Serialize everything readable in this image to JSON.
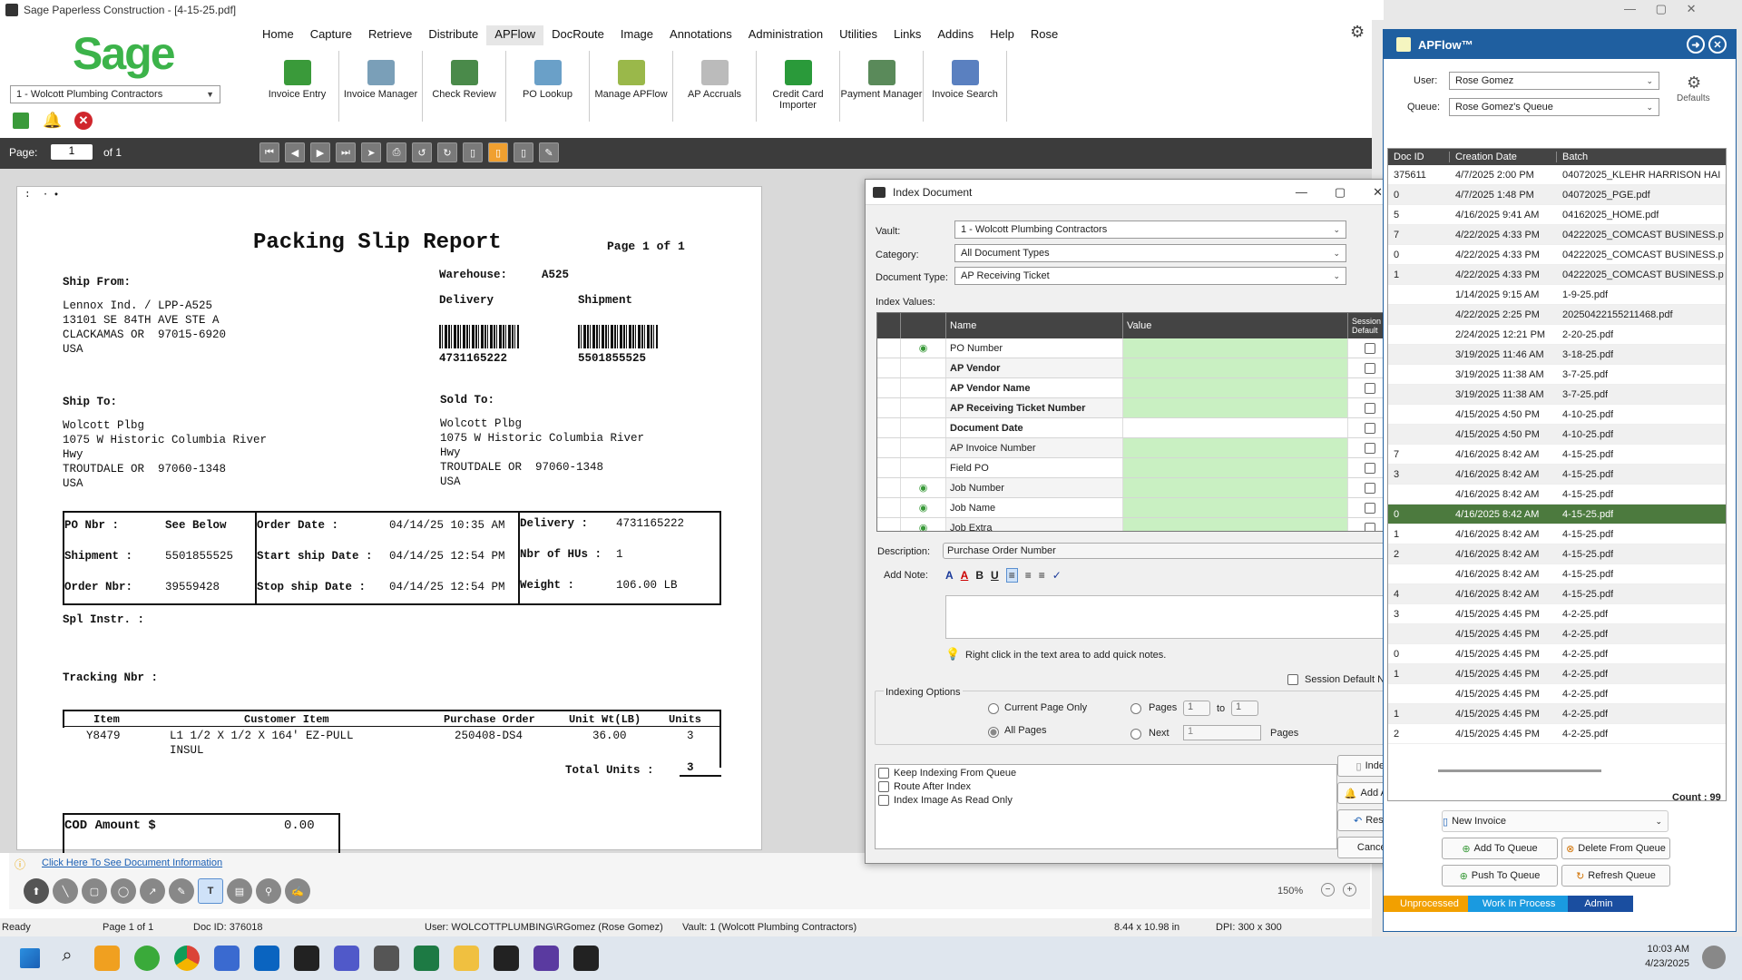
{
  "window": {
    "title": "Sage Paperless Construction - [4-15-25.pdf]"
  },
  "brand": {
    "logo": "Sage",
    "color": "#3cb34a"
  },
  "vault_select": "1 - Wolcott Plumbing Contractors",
  "menu": [
    "Home",
    "Capture",
    "Retrieve",
    "Distribute",
    "APFlow",
    "DocRoute",
    "Image",
    "Annotations",
    "Administration",
    "Utilities",
    "Links",
    "Addins",
    "Help",
    "Rose"
  ],
  "ribbon": [
    {
      "label": "Invoice Entry",
      "icon": "invoice-entry-icon",
      "color": "#3a9a3a"
    },
    {
      "label": "Invoice Manager",
      "icon": "invoice-manager-icon",
      "color": "#7a9fb8"
    },
    {
      "label": "Check Review",
      "icon": "check-review-icon",
      "color": "#4a8a4a"
    },
    {
      "label": "PO Lookup",
      "icon": "po-lookup-icon",
      "color": "#6aa0c8"
    },
    {
      "label": "Manage APFlow",
      "icon": "manage-apflow-icon",
      "color": "#9ab84a"
    },
    {
      "label": "AP Accruals",
      "icon": "ap-accruals-icon",
      "color": "#bbbbbb"
    },
    {
      "label": "Credit Card Importer",
      "icon": "credit-card-icon",
      "color": "#2a9a3a"
    },
    {
      "label": "Payment Manager",
      "icon": "payment-manager-icon",
      "color": "#5a8a5a"
    },
    {
      "label": "Invoice Search",
      "icon": "invoice-search-icon",
      "color": "#5a80c0"
    }
  ],
  "pager": {
    "label": "Page:",
    "current": "1",
    "of": "of 1"
  },
  "document": {
    "title": "Packing Slip Report",
    "page": "Page 1 of 1",
    "ship_from_label": "Ship From:",
    "ship_from": [
      "Lennox Ind. / LPP-A525",
      "13101 SE 84TH AVE STE A",
      "CLACKAMAS OR  97015-6920",
      "USA"
    ],
    "warehouse_label": "Warehouse:",
    "warehouse": "A525",
    "delivery_label": "Delivery",
    "shipment_label": "Shipment",
    "delivery_no": "4731165222",
    "shipment_no": "5501855525",
    "ship_to_label": "Ship To:",
    "sold_to_label": "Sold To:",
    "ship_to": [
      "Wolcott Plbg",
      "1075 W Historic Columbia River",
      "Hwy",
      "TROUTDALE OR  97060-1348",
      "USA"
    ],
    "sold_to": [
      "Wolcott Plbg",
      "1075 W Historic Columbia River",
      "Hwy",
      "TROUTDALE OR  97060-1348",
      "USA"
    ],
    "box": {
      "po_nbr": "PO Nbr :",
      "po_val": "See Below",
      "shipment": "Shipment :",
      "shipment_val": "5501855525",
      "order_nbr": "Order Nbr:",
      "order_val": "39559428",
      "order_date": "Order Date :",
      "order_date_val": "04/14/25 10:35 AM",
      "start_ship": "Start ship Date :",
      "start_ship_val": "04/14/25 12:54 PM",
      "stop_ship": "Stop ship Date :",
      "stop_ship_val": "04/14/25 12:54 PM",
      "delivery": "Delivery :",
      "delivery_val": "4731165222",
      "hus": "Nbr of HUs :",
      "hus_val": "1",
      "weight": "Weight :",
      "weight_val": "106.00 LB"
    },
    "spl_instr": "Spl Instr. :",
    "tracking": "Tracking Nbr :",
    "items_header": [
      "Item",
      "Customer Item",
      "Purchase Order",
      "Unit Wt(LB)",
      "Units"
    ],
    "item": {
      "item": "Y8479",
      "customer_item": "L1 1/2 X 1/2 X 164' EZ-PULL",
      "customer_item2": "INSUL",
      "po": "250408-DS4",
      "wt": "36.00",
      "units": "3"
    },
    "total_units_label": "Total Units :",
    "total_units": "3",
    "cod_label": "COD Amount $",
    "cod_val": "0.00"
  },
  "doc_info_link": "Click Here To See Document Information",
  "zoom": "150%",
  "status": {
    "ready": "Ready",
    "page": "Page 1 of 1",
    "doc_id": "Doc ID: 376018",
    "user": "User: WOLCOTTPLUMBING\\RGomez (Rose Gomez)",
    "vault": "Vault: 1 (Wolcott Plumbing Contractors)",
    "size": "8.44 x 10.98 in",
    "dpi": "DPI: 300 x 300"
  },
  "dialog": {
    "title": "Index Document",
    "vault_label": "Vault:",
    "vault": "1 - Wolcott Plumbing Contractors",
    "category_label": "Category:",
    "category": "All Document Types",
    "doctype_label": "Document Type:",
    "doctype": "AP Receiving Ticket",
    "index_values_label": "Index Values:",
    "col_name": "Name",
    "col_value": "Value",
    "col_session": "Session Default",
    "rows": [
      {
        "name": "PO Number",
        "bold": false,
        "green": true,
        "eye": true
      },
      {
        "name": "AP Vendor",
        "bold": true,
        "green": true,
        "eye": false
      },
      {
        "name": "AP Vendor Name",
        "bold": true,
        "green": true,
        "eye": false
      },
      {
        "name": "AP Receiving Ticket Number",
        "bold": true,
        "green": true,
        "eye": false
      },
      {
        "name": "Document Date",
        "bold": true,
        "green": false,
        "eye": false
      },
      {
        "name": "AP Invoice Number",
        "bold": false,
        "green": true,
        "eye": false
      },
      {
        "name": "Field PO",
        "bold": false,
        "green": true,
        "eye": false
      },
      {
        "name": "Job Number",
        "bold": false,
        "green": true,
        "eye": true
      },
      {
        "name": "Job Name",
        "bold": false,
        "green": true,
        "eye": true
      },
      {
        "name": "Job Extra",
        "bold": false,
        "green": true,
        "eye": true
      }
    ],
    "description_label": "Description:",
    "description": "Purchase Order Number",
    "add_note_label": "Add Note:",
    "hint": "Right click in the text area to add quick notes.",
    "session_default_notes": "Session Default Notes",
    "indexing_options": "Indexing Options",
    "current_page_only": "Current Page Only",
    "all_pages": "All Pages",
    "pages": "Pages",
    "pages_from": "1",
    "to": "to",
    "pages_to": "1",
    "next": "Next",
    "next_val": "1",
    "pages2": "Pages",
    "keep_indexing": "Keep Indexing From Queue",
    "route_after": "Route After Index",
    "read_only": "Index Image As Read Only",
    "btn_index": "Index",
    "btn_alert": "Add Alert",
    "btn_reset": "Reset",
    "btn_cancel": "Cancel"
  },
  "apflow": {
    "title": "APFlow™",
    "user_label": "User:",
    "user": "Rose Gomez",
    "queue_label": "Queue:",
    "queue": "Rose Gomez's Queue",
    "defaults": "Defaults",
    "cols": [
      "Doc ID",
      "Creation Date",
      "Batch"
    ],
    "rows": [
      [
        "375611",
        "4/7/2025 2:00 PM",
        "04072025_KLEHR HARRISON HAI"
      ],
      [
        "0",
        "4/7/2025 1:48 PM",
        "04072025_PGE.pdf"
      ],
      [
        "5",
        "4/16/2025 9:41 AM",
        "04162025_HOME.pdf"
      ],
      [
        "7",
        "4/22/2025 4:33 PM",
        "04222025_COMCAST BUSINESS.p"
      ],
      [
        "0",
        "4/22/2025 4:33 PM",
        "04222025_COMCAST BUSINESS.p"
      ],
      [
        "1",
        "4/22/2025 4:33 PM",
        "04222025_COMCAST BUSINESS.p"
      ],
      [
        "",
        "1/14/2025 9:15 AM",
        "1-9-25.pdf"
      ],
      [
        "",
        "4/22/2025 2:25 PM",
        "20250422155211468.pdf"
      ],
      [
        "",
        "2/24/2025 12:21 PM",
        "2-20-25.pdf"
      ],
      [
        "",
        "3/19/2025 11:46 AM",
        "3-18-25.pdf"
      ],
      [
        "",
        "3/19/2025 11:38 AM",
        "3-7-25.pdf"
      ],
      [
        "",
        "3/19/2025 11:38 AM",
        "3-7-25.pdf"
      ],
      [
        "",
        "4/15/2025 4:50 PM",
        "4-10-25.pdf"
      ],
      [
        "",
        "4/15/2025 4:50 PM",
        "4-10-25.pdf"
      ],
      [
        "7",
        "4/16/2025 8:42 AM",
        "4-15-25.pdf"
      ],
      [
        "3",
        "4/16/2025 8:42 AM",
        "4-15-25.pdf"
      ],
      [
        "",
        "4/16/2025 8:42 AM",
        "4-15-25.pdf"
      ],
      [
        "0",
        "4/16/2025 8:42 AM",
        "4-15-25.pdf"
      ],
      [
        "1",
        "4/16/2025 8:42 AM",
        "4-15-25.pdf"
      ],
      [
        "2",
        "4/16/2025 8:42 AM",
        "4-15-25.pdf"
      ],
      [
        "",
        "4/16/2025 8:42 AM",
        "4-15-25.pdf"
      ],
      [
        "4",
        "4/16/2025 8:42 AM",
        "4-15-25.pdf"
      ],
      [
        "3",
        "4/15/2025 4:45 PM",
        "4-2-25.pdf"
      ],
      [
        "",
        "4/15/2025 4:45 PM",
        "4-2-25.pdf"
      ],
      [
        "0",
        "4/15/2025 4:45 PM",
        "4-2-25.pdf"
      ],
      [
        "1",
        "4/15/2025 4:45 PM",
        "4-2-25.pdf"
      ],
      [
        "",
        "4/15/2025 4:45 PM",
        "4-2-25.pdf"
      ],
      [
        "1",
        "4/15/2025 4:45 PM",
        "4-2-25.pdf"
      ],
      [
        "2",
        "4/15/2025 4:45 PM",
        "4-2-25.pdf"
      ]
    ],
    "selected_row": 17,
    "count": "Count : 99",
    "new_invoice": "New Invoice",
    "add_to_queue": "Add To Queue",
    "delete_from_queue": "Delete From Queue",
    "push_to_queue": "Push To Queue",
    "refresh_queue": "Refresh Queue",
    "tabs": [
      "Unprocessed",
      "Work In Process",
      "Admin"
    ]
  },
  "clock": {
    "time": "10:03 AM",
    "date": "4/23/2025"
  }
}
